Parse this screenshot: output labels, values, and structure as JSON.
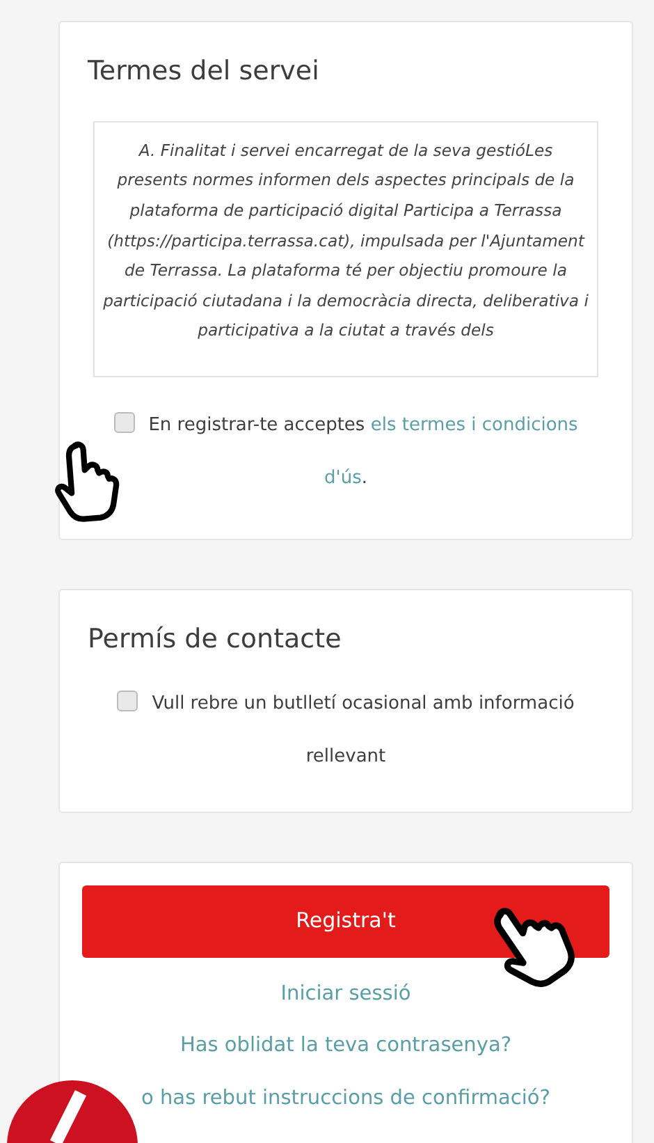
{
  "terms_card": {
    "title": "Termes del servei",
    "terms_lines": [
      "A. Finalitat i servei encarregat de la seva gestióLes presents normes informen dels aspectes principals de la plataforma de participació digital Participa a Terrassa (https://participa.terrassa.cat), impulsada per l'Ajuntament de Terrassa. La plataforma té per objectiu promoure la participació ciutadana i la democràcia directa, deliberativa i participativa a la ciutat a través dels"
    ],
    "accept": {
      "checked": false,
      "text": "En registrar-te acceptes ",
      "link_lines": [
        "els termes i condicions",
        "d'ús"
      ],
      "after": "."
    }
  },
  "contact_card": {
    "title": "Permís de contacte",
    "newsletter": {
      "checked": false,
      "text": "Vull rebre un butlletí ocasional amb informació rellevant"
    }
  },
  "actions": {
    "register_button": "Registra't",
    "links": [
      "Iniciar sessió",
      "Has oblidat la teva contrasenya?",
      "o has rebut instruccions de confirmació?"
    ]
  }
}
